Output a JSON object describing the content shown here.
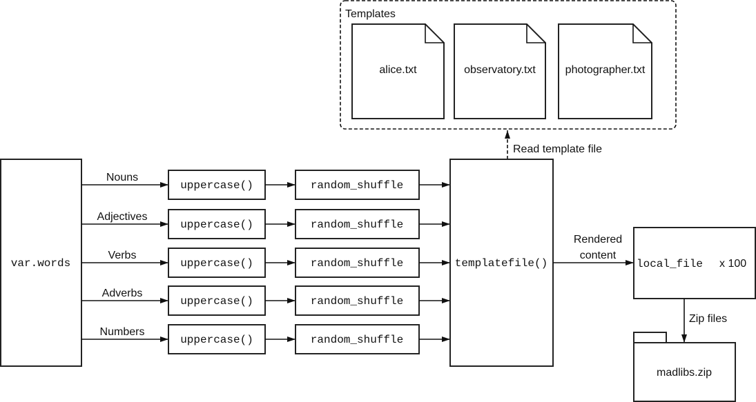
{
  "templates": {
    "title": "Templates",
    "files": [
      "alice.txt",
      "observatory.txt",
      "photographer.txt"
    ]
  },
  "read_label": "Read template file",
  "source": "var.words",
  "rows": [
    {
      "label": "Nouns",
      "fn1": "uppercase()",
      "fn2": "random_shuffle"
    },
    {
      "label": "Adjectives",
      "fn1": "uppercase()",
      "fn2": "random_shuffle"
    },
    {
      "label": "Verbs",
      "fn1": "uppercase()",
      "fn2": "random_shuffle"
    },
    {
      "label": "Adverbs",
      "fn1": "uppercase()",
      "fn2": "random_shuffle"
    },
    {
      "label": "Numbers",
      "fn1": "uppercase()",
      "fn2": "random_shuffle"
    }
  ],
  "templatefile": "templatefile()",
  "rendered_label": [
    "Rendered",
    "content"
  ],
  "local_file": {
    "code": "local_file",
    "count": "x 100"
  },
  "zip_label": "Zip files",
  "archive": "madlibs.zip"
}
